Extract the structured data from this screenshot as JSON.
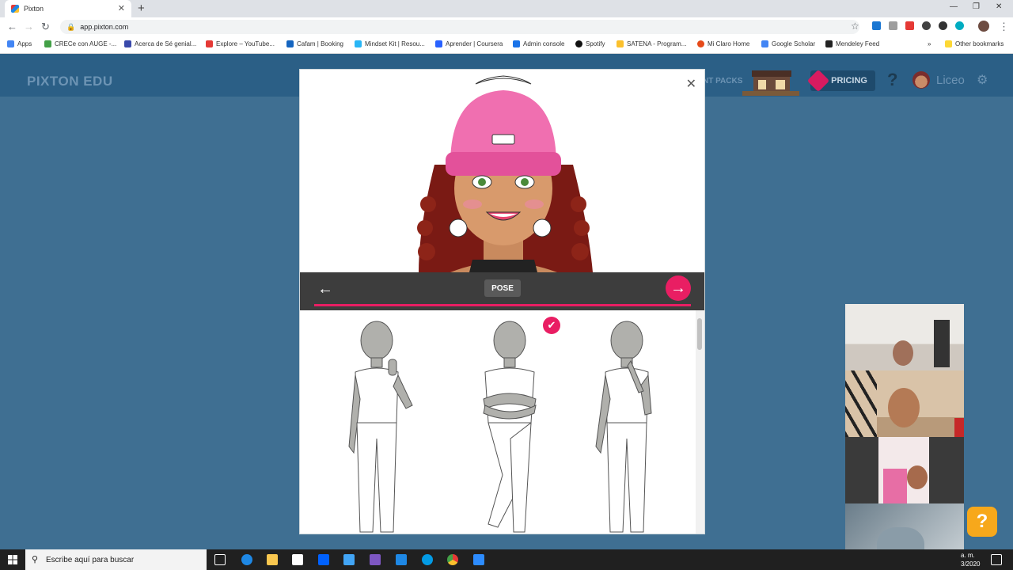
{
  "browser": {
    "tab_title": "Pixton",
    "url": "app.pixton.com",
    "bookmarks": [
      "Apps",
      "CRECe con AUGE -...",
      "Acerca de Sé genial...",
      "Explore – YouTube...",
      "Cafam | Booking",
      "Mindset Kit | Resou...",
      "Aprender | Coursera",
      "Admin console",
      "Spotify",
      "SATENA - Program...",
      "Mi Claro Home",
      "Google Scholar",
      "Mendeley Feed"
    ],
    "other_bookmarks": "Other bookmarks",
    "overflow": "»"
  },
  "app": {
    "logo": "PIXTON EDU",
    "packs_label": "NT PACKS",
    "pricing_label": "PRICING",
    "help_label": "?",
    "account_label": "Liceo"
  },
  "editor": {
    "step_label": "POSE",
    "close_label": "✕",
    "back_label": "←",
    "next_label": "→",
    "selected_pose": "arms-crossed",
    "poses": [
      "thumbs-up",
      "arms-crossed",
      "hand-on-chin"
    ]
  },
  "taskbar": {
    "search_placeholder": "Escribe aquí para buscar",
    "time": "a. m.",
    "date": "3/2020"
  },
  "help_bubble": "?"
}
